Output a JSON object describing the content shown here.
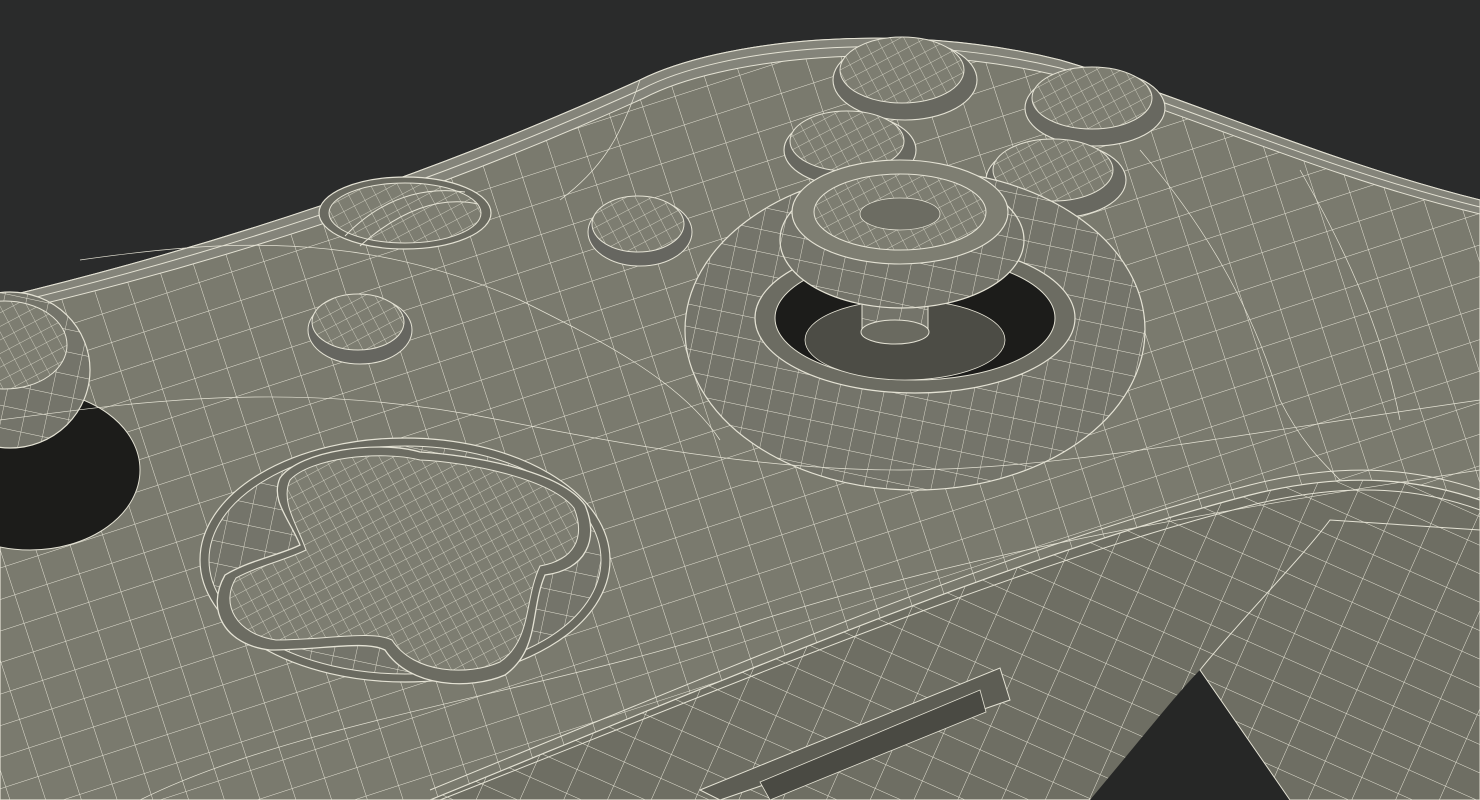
{
  "scene": {
    "subject": "game-controller-wireframe",
    "colors": {
      "background": "#2a2b2b",
      "surface": "#7a7a6e",
      "surface_dark": "#5f5f55",
      "shadow": "#1c1c1a",
      "wire": "#e4e2d4"
    }
  }
}
